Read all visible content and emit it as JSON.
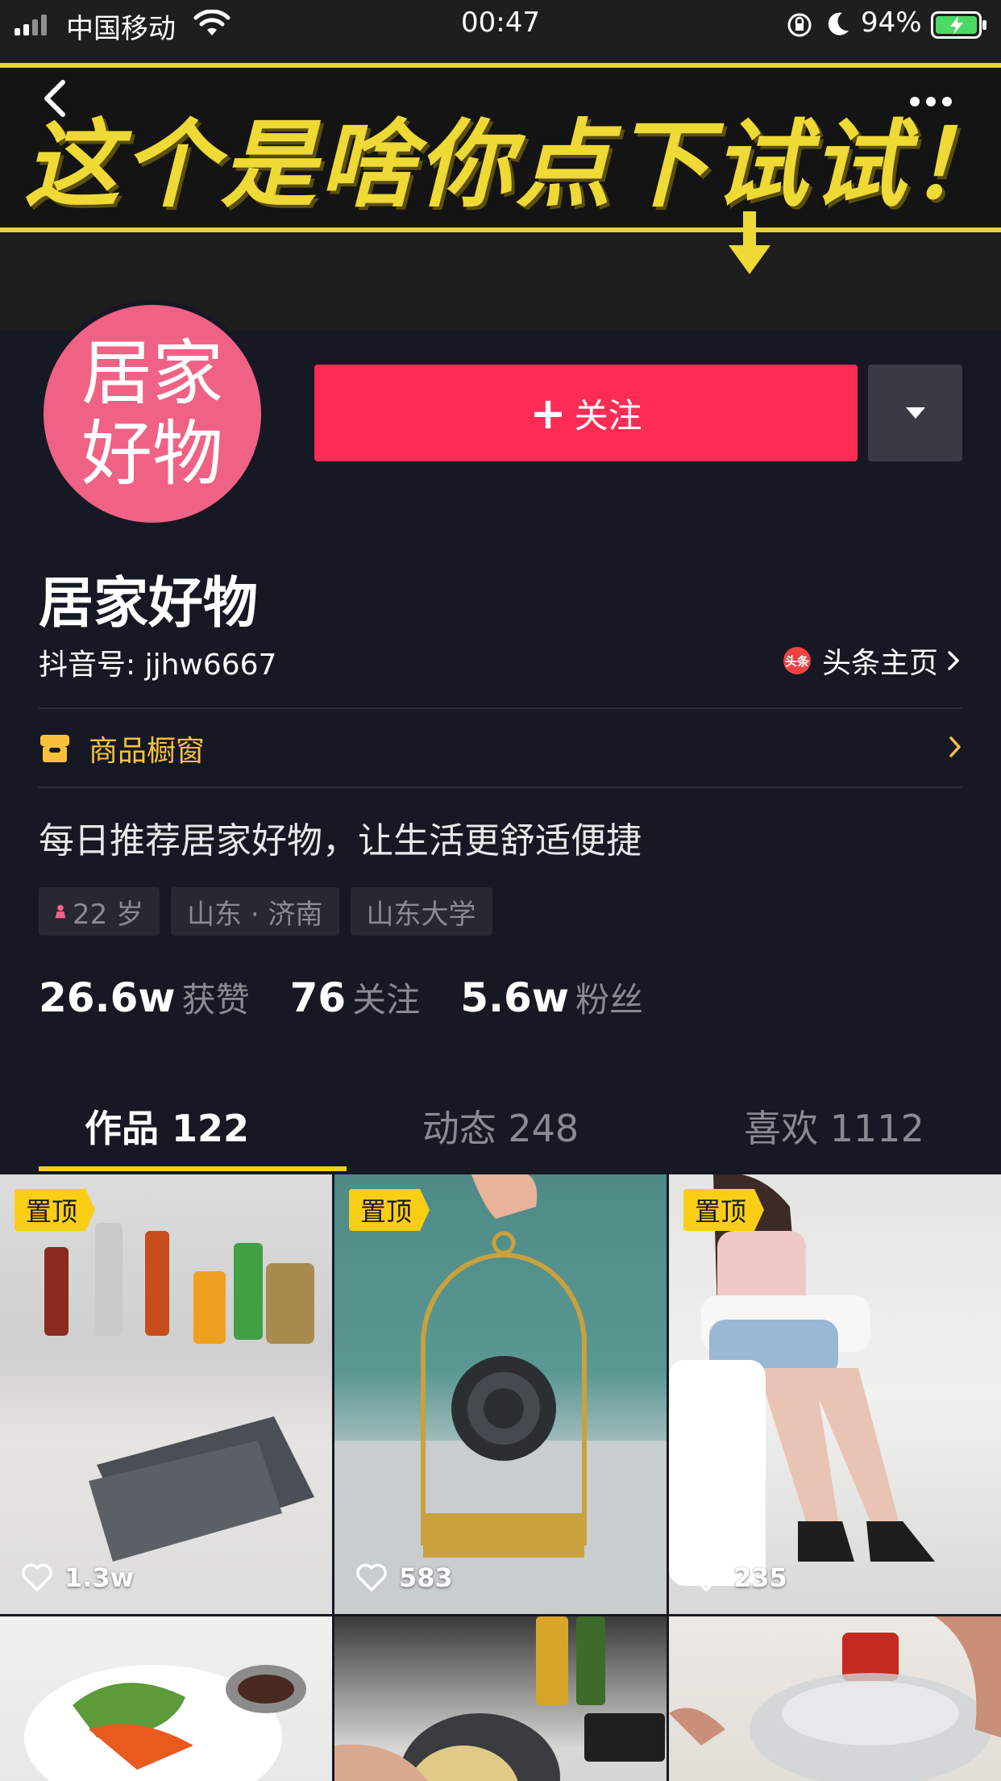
{
  "status_bar": {
    "carrier": "中国移动",
    "time": "00:47",
    "battery_percent": "94%"
  },
  "banner": {
    "text": "这个是啥你点下试试！"
  },
  "profile": {
    "avatar_line1": "居家",
    "avatar_line2": "好物",
    "follow_label": "关注",
    "name": "居家好物",
    "douyin_id": "抖音号: jjhw6667",
    "toutiao_logo_text": "头条",
    "toutiao_label": "头条主页",
    "shop_label": "商品橱窗",
    "bio": "每日推荐居家好物，让生活更舒适便捷",
    "tags": [
      "22 岁",
      "山东 · 济南",
      "山东大学"
    ],
    "stats": [
      {
        "num": "26.6w",
        "label": "获赞"
      },
      {
        "num": "76",
        "label": "关注"
      },
      {
        "num": "5.6w",
        "label": "粉丝"
      }
    ]
  },
  "tabs": [
    {
      "label": "作品 122",
      "active": true
    },
    {
      "label": "动态 248",
      "active": false
    },
    {
      "label": "喜欢 1112",
      "active": false
    }
  ],
  "videos": [
    {
      "pinned": "置顶",
      "likes": "1.3w"
    },
    {
      "pinned": "置顶",
      "likes": "583"
    },
    {
      "pinned": "置顶",
      "likes": "235"
    }
  ],
  "colors": {
    "background": "#161823",
    "follow": "#fe2c55",
    "accent_yellow": "#face15",
    "avatar": "#f06285"
  }
}
